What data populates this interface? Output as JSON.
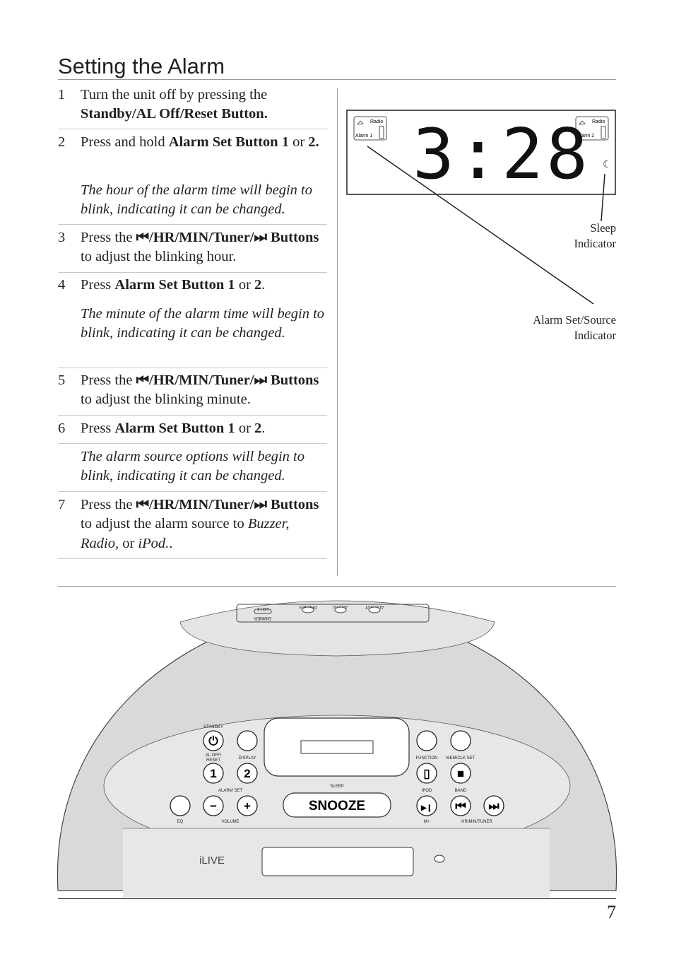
{
  "title": "Setting the Alarm",
  "steps": [
    {
      "num": "1",
      "segments": [
        {
          "t": "Turn the unit off by pressing the "
        },
        {
          "t": "Standby/AL Off/Reset Button.",
          "b": true
        }
      ]
    },
    {
      "num": "2",
      "segments": [
        {
          "t": "Press and hold "
        },
        {
          "t": "Alarm Set Button 1",
          "b": true
        },
        {
          "t": " or "
        },
        {
          "t": "2.",
          "b": true
        }
      ],
      "note": "The hour of the alarm time will begin to blink, indicating it can be changed."
    },
    {
      "num": "3",
      "segments": [
        {
          "t": "Press the "
        },
        {
          "t": "⏮/HR/MIN/Tuner/⏭ Buttons",
          "b": true
        },
        {
          "t": " to adjust the blinking hour."
        }
      ]
    },
    {
      "num": "4",
      "segments": [
        {
          "t": "Press "
        },
        {
          "t": "Alarm Set Button 1",
          "b": true
        },
        {
          "t": " or "
        },
        {
          "t": "2",
          "b": true
        },
        {
          "t": "."
        }
      ],
      "note": "The minute of the alarm time will begin to blink, indicating it can be changed."
    },
    {
      "num": "5",
      "segments": [
        {
          "t": "Press the "
        },
        {
          "t": "⏮/HR/MIN/Tuner/⏭ Buttons",
          "b": true
        },
        {
          "t": " to adjust the blinking minute."
        }
      ]
    },
    {
      "num": "6",
      "segments": [
        {
          "t": "Press "
        },
        {
          "t": "Alarm Set Button 1",
          "b": true
        },
        {
          "t": " or "
        },
        {
          "t": "2",
          "b": true
        },
        {
          "t": "."
        }
      ],
      "note": "The alarm source options will begin to blink, indicating it can be changed.",
      "note_separate": true
    },
    {
      "num": "7",
      "segments": [
        {
          "t": "Press the  "
        },
        {
          "t": "⏮/HR/MIN/Tuner/⏭ Buttons",
          "b": true
        },
        {
          "t": " to adjust the alarm source to "
        },
        {
          "t": "Buzzer, Radio,",
          "i": true
        },
        {
          "t": " or "
        },
        {
          "t": "iPod.",
          "i": true
        },
        {
          "t": "."
        }
      ]
    }
  ],
  "lcd": {
    "time": "3:28",
    "alarm1_label": "Alarm 1",
    "alarm2_label": "Alarm 2",
    "radio_label": "Radio",
    "icons": [
      "bell-icon",
      "ipod-icon",
      "moon-sleep-icon"
    ]
  },
  "callouts": {
    "sleep": [
      "Sleep",
      "Indicator"
    ],
    "alarm": [
      "Alarm Set/Source",
      "Indicator"
    ]
  },
  "device": {
    "top_labels": {
      "dimmer": "DIMMER",
      "lohi": "LO   HI",
      "phones": "PHONES",
      "aux_in": "AUX IN",
      "aux_out": "AUX OUT"
    },
    "standby": "STANDBY",
    "al_off": "AL OFF/",
    "reset": "RESET",
    "display": "DISPLAY",
    "btn1": "1",
    "btn2": "2",
    "alarm_set": "ALARM SET",
    "sleep": "SLEEP",
    "snooze": "SNOOZE",
    "eq": "EQ",
    "volume": "VOLUME",
    "function": "FUNCTION",
    "mem": "MEM/CLK SET",
    "ipod": "IPOD",
    "band": "BAND",
    "mplus": "M+",
    "hrmin": "HR/MIN/TUNER",
    "logo": "iLIVE"
  },
  "page_number": "7"
}
